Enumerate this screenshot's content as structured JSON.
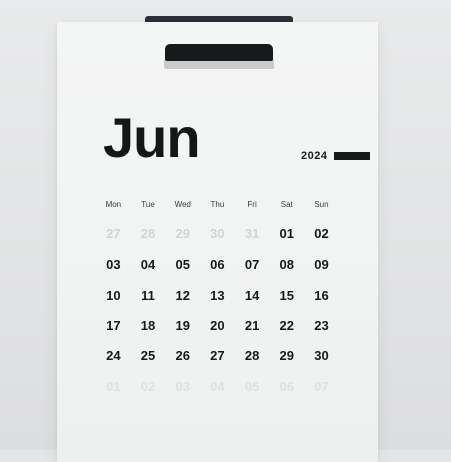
{
  "calendar": {
    "month": "Jun",
    "year": "2024",
    "weekdays": [
      "Mon",
      "Tue",
      "Wed",
      "Thu",
      "Fri",
      "Sat",
      "Sun"
    ],
    "weeks": [
      [
        {
          "label": "27",
          "current": false
        },
        {
          "label": "28",
          "current": false
        },
        {
          "label": "29",
          "current": false
        },
        {
          "label": "30",
          "current": false
        },
        {
          "label": "31",
          "current": false
        },
        {
          "label": "01",
          "current": true
        },
        {
          "label": "02",
          "current": true
        }
      ],
      [
        {
          "label": "03",
          "current": true
        },
        {
          "label": "04",
          "current": true
        },
        {
          "label": "05",
          "current": true
        },
        {
          "label": "06",
          "current": true
        },
        {
          "label": "07",
          "current": true
        },
        {
          "label": "08",
          "current": true
        },
        {
          "label": "09",
          "current": true
        }
      ],
      [
        {
          "label": "10",
          "current": true
        },
        {
          "label": "11",
          "current": true
        },
        {
          "label": "12",
          "current": true
        },
        {
          "label": "13",
          "current": true
        },
        {
          "label": "14",
          "current": true
        },
        {
          "label": "15",
          "current": true
        },
        {
          "label": "16",
          "current": true
        }
      ],
      [
        {
          "label": "17",
          "current": true
        },
        {
          "label": "18",
          "current": true
        },
        {
          "label": "19",
          "current": true
        },
        {
          "label": "20",
          "current": true
        },
        {
          "label": "21",
          "current": true
        },
        {
          "label": "22",
          "current": true
        },
        {
          "label": "23",
          "current": true
        }
      ],
      [
        {
          "label": "24",
          "current": true
        },
        {
          "label": "25",
          "current": true
        },
        {
          "label": "26",
          "current": true
        },
        {
          "label": "27",
          "current": true
        },
        {
          "label": "28",
          "current": true
        },
        {
          "label": "29",
          "current": true
        },
        {
          "label": "30",
          "current": true
        }
      ],
      [
        {
          "label": "01",
          "current": false
        },
        {
          "label": "02",
          "current": false
        },
        {
          "label": "03",
          "current": false
        },
        {
          "label": "04",
          "current": false
        },
        {
          "label": "05",
          "current": false
        },
        {
          "label": "06",
          "current": false
        },
        {
          "label": "07",
          "current": false
        }
      ]
    ]
  },
  "colors": {
    "ink": "#141618",
    "faded_day": "#d2d4d6",
    "background": "#e4e5e6",
    "sheet": "#f3f4f4",
    "clip": "#17191b"
  }
}
